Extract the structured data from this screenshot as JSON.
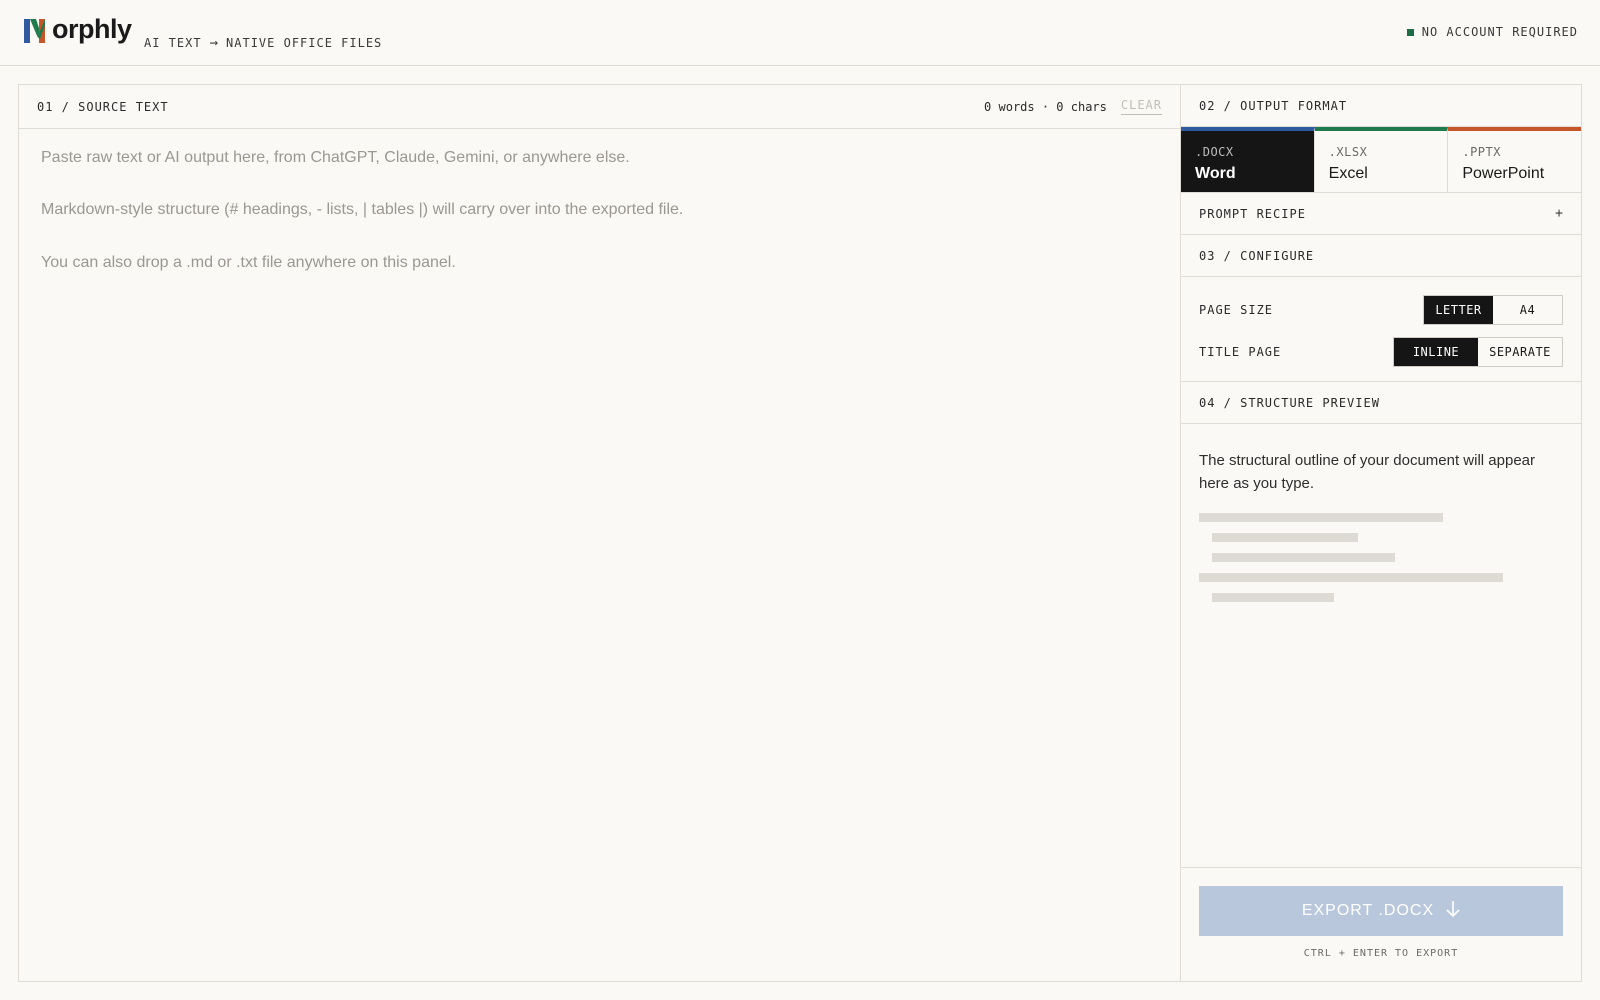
{
  "brand": {
    "logo_first_letter": "M",
    "logo_rest": "orphly",
    "tagline_left": "AI TEXT",
    "tagline_right": "NATIVE OFFICE FILES",
    "status": "NO ACCOUNT REQUIRED",
    "colors": {
      "blue": "#2f5aa0",
      "green": "#1f7a4d",
      "orange": "#c5562a",
      "status_dot": "#1f6b45"
    }
  },
  "source": {
    "section_label": "01 / SOURCE TEXT",
    "counts": "0 words · 0 chars",
    "clear_label": "CLEAR",
    "placeholder_lines": [
      "Paste raw text or AI output here, from ChatGPT, Claude, Gemini, or anywhere else.",
      "Markdown-style structure (# headings, - lists, | tables |) will carry over into the exported file.",
      "You can also drop a .md or .txt file anywhere on this panel."
    ]
  },
  "output": {
    "section_label": "02 / OUTPUT FORMAT",
    "formats": [
      {
        "ext": ".DOCX",
        "name": "Word",
        "color": "#2f5aa0",
        "active": true
      },
      {
        "ext": ".XLSX",
        "name": "Excel",
        "color": "#1f7a4d",
        "active": false
      },
      {
        "ext": ".PPTX",
        "name": "PowerPoint",
        "color": "#c5562a",
        "active": false
      }
    ]
  },
  "recipe": {
    "label": "PROMPT RECIPE",
    "toggle": "+"
  },
  "configure": {
    "section_label": "03 / CONFIGURE",
    "page_size": {
      "label": "PAGE SIZE",
      "options": [
        "LETTER",
        "A4"
      ],
      "selected": "LETTER"
    },
    "title_page": {
      "label": "TITLE PAGE",
      "options": [
        "INLINE",
        "SEPARATE"
      ],
      "selected": "INLINE"
    }
  },
  "preview": {
    "section_label": "04 / STRUCTURE PREVIEW",
    "text": "The structural outline of your document will appear here as you type."
  },
  "export": {
    "button_label": "EXPORT .DOCX",
    "hint": "CTRL + ENTER TO EXPORT"
  }
}
